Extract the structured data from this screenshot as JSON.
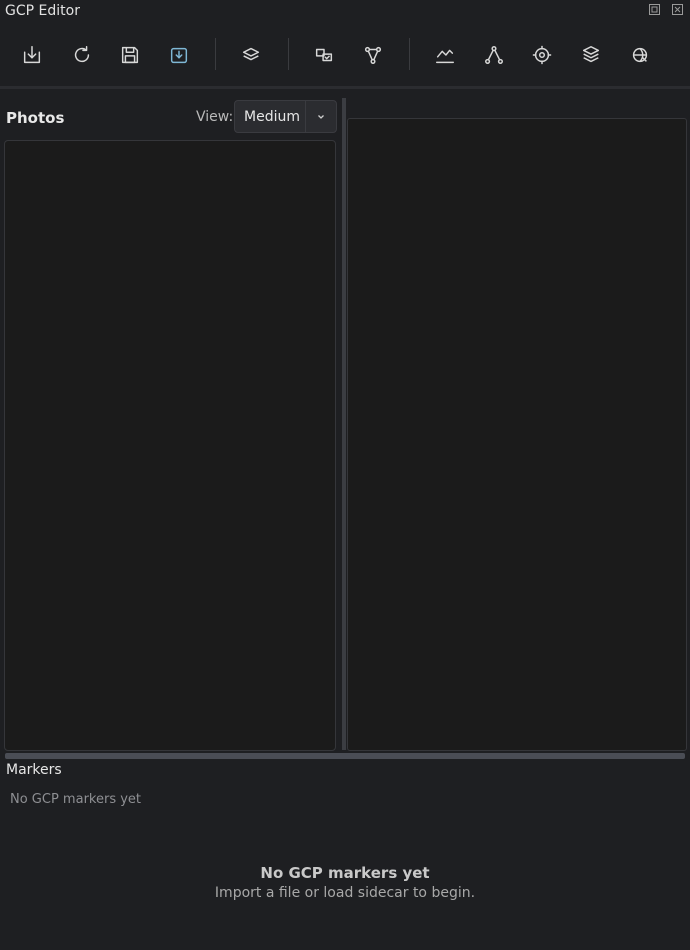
{
  "window": {
    "title": "GCP Editor"
  },
  "toolbar": {
    "items": [
      {
        "icon": "import-icon"
      },
      {
        "icon": "reload-icon"
      },
      {
        "icon": "save-icon"
      },
      {
        "icon": "download-tray-icon"
      },
      {
        "icon": "layers-icon"
      },
      {
        "icon": "transform-icon"
      },
      {
        "icon": "triangulate-icon"
      },
      {
        "icon": "chart-icon"
      },
      {
        "icon": "graph-icon"
      },
      {
        "icon": "target-icon"
      },
      {
        "icon": "stack-icon"
      },
      {
        "icon": "globe-icon"
      }
    ],
    "accent_color": "#7fb8d6"
  },
  "photos": {
    "title": "Photos",
    "view_label": "View:",
    "view_value": "Medium"
  },
  "markers": {
    "title": "Markers",
    "empty_text": "No GCP markers yet"
  },
  "empty_state": {
    "title": "No GCP markers yet",
    "subtitle": "Import a file or load sidecar to begin."
  }
}
